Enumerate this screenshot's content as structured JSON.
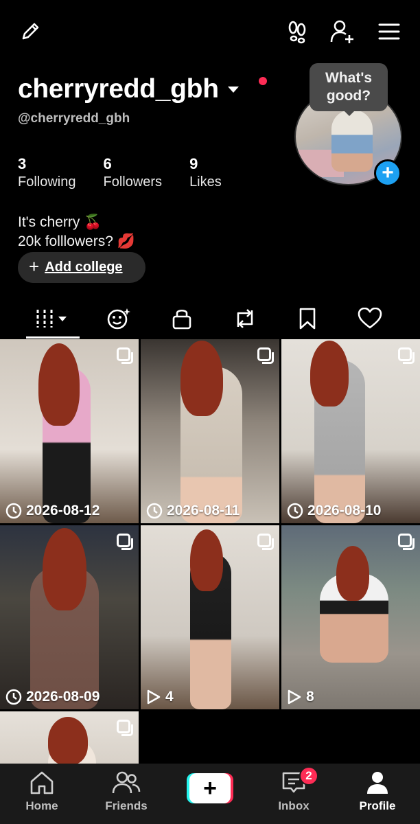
{
  "header": {
    "username": "cherryredd_gbh",
    "handle": "@cherryredd_gbh",
    "icons": [
      "edit-icon",
      "footprints-icon",
      "add-friend-icon",
      "menu-icon"
    ]
  },
  "avatar_bubble": "What's good?",
  "stats": [
    {
      "value": "3",
      "label": "Following"
    },
    {
      "value": "6",
      "label": "Followers"
    },
    {
      "value": "9",
      "label": "Likes"
    }
  ],
  "bio": {
    "line1": "It's cherry 🍒",
    "line2": "20k folllowers? 💋"
  },
  "add_college": {
    "plus": "+",
    "label": "Add college"
  },
  "tabs": [
    "videos-grid-icon",
    "reposts-face-icon",
    "lock-icon",
    "repost-icon",
    "bookmark-icon",
    "heart-icon"
  ],
  "posts": [
    {
      "kind": "draft-date",
      "text": "2026-08-12"
    },
    {
      "kind": "draft-date",
      "text": "2026-08-11"
    },
    {
      "kind": "draft-date",
      "text": "2026-08-10"
    },
    {
      "kind": "draft-date",
      "text": "2026-08-09"
    },
    {
      "kind": "plays",
      "text": "4"
    },
    {
      "kind": "plays",
      "text": "8"
    },
    {
      "kind": "none",
      "text": ""
    }
  ],
  "nav": [
    {
      "label": "Home"
    },
    {
      "label": "Friends"
    },
    {
      "label": "+"
    },
    {
      "label": "Inbox",
      "badge": "2"
    },
    {
      "label": "Profile",
      "active": true
    }
  ],
  "colors": {
    "accent_red": "#fe2c55",
    "accent_cyan": "#25f4ee",
    "add_blue": "#1da1f2"
  }
}
